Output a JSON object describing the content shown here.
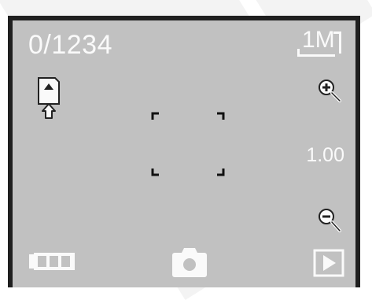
{
  "status_bar": {
    "shot_counter": "0/1234",
    "resolution": "1M",
    "resolution_icon": "image-size-icon"
  },
  "storage": {
    "icon": "sd-card-icon"
  },
  "zoom": {
    "value": "1.00",
    "zoom_in_icon": "zoom-in-icon",
    "zoom_out_icon": "zoom-out-icon"
  },
  "focus": {
    "icon": "focus-frame-icon"
  },
  "bottom_bar": {
    "battery_icon": "battery-icon",
    "mode_icon": "camera-icon",
    "playback_icon": "play-icon"
  },
  "colors": {
    "screen_background": "#c1c1c1",
    "screen_border": "#1f1f1f",
    "overlay_foreground": "#fafafa",
    "focus_marks": "#111111"
  }
}
